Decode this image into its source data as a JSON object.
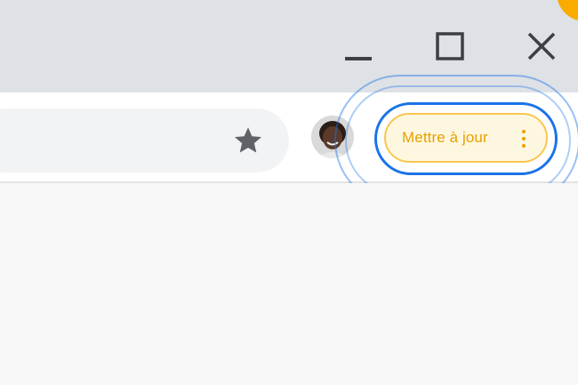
{
  "window": {
    "controls": {
      "minimize_icon": "minimize-icon",
      "maximize_icon": "maximize-icon",
      "close_icon": "close-icon"
    }
  },
  "toolbar": {
    "bookmark_icon": "star-icon",
    "profile_avatar": "profile-avatar",
    "update_button": {
      "label": "Mettre à jour",
      "menu_icon": "kebab-menu-icon"
    }
  },
  "colors": {
    "titlebar": "#dee1e6",
    "toolbar": "#ffffff",
    "omnibox": "#f1f3f4",
    "accent_yellow": "#f9ab00",
    "update_text": "#e6a100",
    "update_bg": "#fef7e0",
    "focus_ring": "#1a73e8",
    "icon_gray": "#5f6368"
  }
}
